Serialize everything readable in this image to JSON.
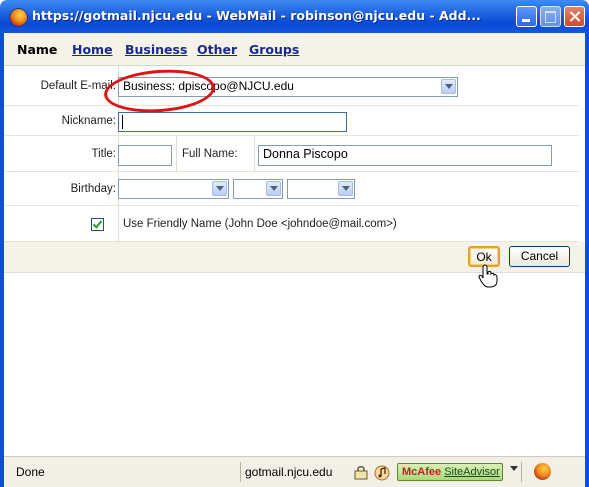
{
  "window": {
    "title": "https://gotmail.njcu.edu - WebMail - robinson@njcu.edu - Add...",
    "icon": "firefox-icon"
  },
  "tabs": [
    {
      "label": "Name",
      "active": true
    },
    {
      "label": "Home",
      "active": false
    },
    {
      "label": "Business",
      "active": false
    },
    {
      "label": "Other",
      "active": false
    },
    {
      "label": "Groups",
      "active": false
    }
  ],
  "form": {
    "default_email": {
      "label": "Default E-mail:",
      "value": "Business: dpiscopo@NJCU.edu"
    },
    "nickname": {
      "label": "Nickname:",
      "value": ""
    },
    "title": {
      "label": "Title:",
      "value": ""
    },
    "full_name": {
      "label": "Full Name:",
      "value": "Donna Piscopo"
    },
    "birthday": {
      "label": "Birthday:",
      "month": "",
      "day": "",
      "year": ""
    },
    "friendly_name": {
      "label": "Use Friendly Name (John Doe <johndoe@mail.com>)",
      "checked": true
    }
  },
  "buttons": {
    "ok": "Ok",
    "cancel": "Cancel"
  },
  "statusbar": {
    "status": "Done",
    "domain": "gotmail.njcu.edu",
    "siteadvisor_brand": "McAfee",
    "siteadvisor_product": "SiteAdvisor"
  },
  "colors": {
    "titlebar": "#0a4ad2",
    "link": "#1a2a8a",
    "highlight_circle": "#e01212",
    "ok_focus": "#e8a033"
  }
}
